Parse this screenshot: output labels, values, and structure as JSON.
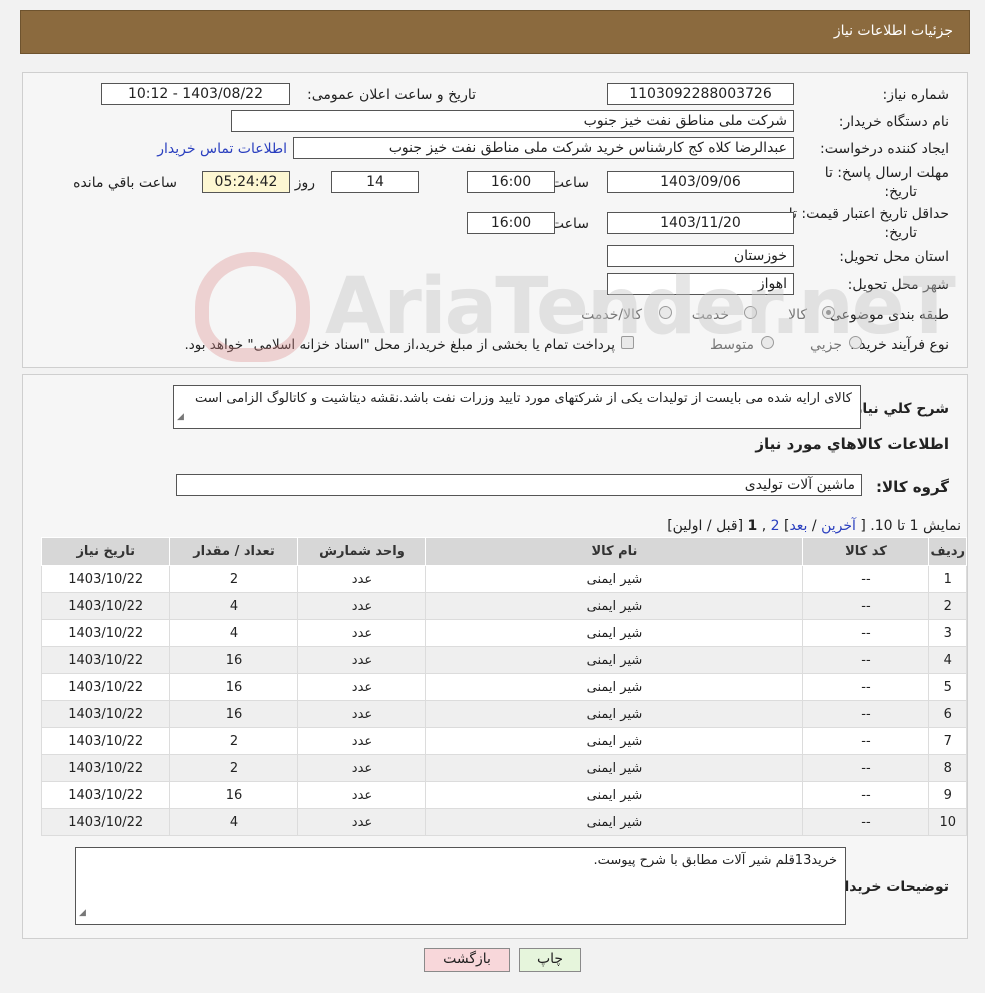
{
  "header": {
    "title": "جزئیات اطلاعات نیاز"
  },
  "details": {
    "need_number_label": "شماره نیاز:",
    "need_number": "1103092288003726",
    "announce_label": "تاریخ و ساعت اعلان عمومی:",
    "announce_value": "1403/08/22 - 10:12",
    "buyer_org_label": "نام دستگاه خریدار:",
    "buyer_org": "شرکت ملی مناطق نفت خیز جنوب",
    "creator_label": "ایجاد کننده درخواست:",
    "creator": "عبدالرضا کلاه کج  کارشناس خرید شرکت ملی مناطق نفت خیز جنوب",
    "contact_link": "اطلاعات تماس خریدار",
    "deadline_label_1": "مهلت ارسال پاسخ: تا",
    "deadline_label_2": "تاریخ:",
    "deadline_date": "1403/09/06",
    "time_label": "ساعت",
    "deadline_time": "16:00",
    "days_value": "14",
    "days_label": "روز و",
    "remaining_time": "05:24:42",
    "remaining_label": "ساعت باقي مانده",
    "validity_label_1": "حداقل تاریخ اعتبار قیمت: تا",
    "validity_label_2": "تاریخ:",
    "validity_date": "1403/11/20",
    "validity_time": "16:00",
    "province_label": "استان محل تحویل:",
    "province": "خوزستان",
    "city_label": "شهر محل تحویل:",
    "city": "اهواز",
    "category_label": "طبقه بندی موضوعی:",
    "category_options": [
      "کالا",
      "خدمت",
      "کالا/خدمت"
    ],
    "process_label": "نوع فرآیند خرید :",
    "process_options": [
      "جزیي",
      "متوسط"
    ],
    "process_note": "پرداخت تمام یا بخشی از مبلغ خرید،از محل \"اسناد خزانه اسلامی\" خواهد بود."
  },
  "watermark": {
    "text": "AriaTender.neT"
  },
  "items_section": {
    "description_label": "شرح كلي نياز:",
    "description": "کالای ارایه شده می بایست از تولیدات یکی از شرکتهای مورد تایید وزرات نفت باشد.نقشه دیتاشیت و کاتالوگ الزامی است",
    "section_title": "اطلاعات كالاهاي مورد نياز",
    "group_label": "گروه كالا:",
    "group_value": "ماشین آلات تولیدی",
    "paging_text": "نمایش 1 تا 10.",
    "paging_bracket_open": "[",
    "paging_last": "آخرین",
    "paging_sep1": "/",
    "paging_next": "بعد",
    "paging_bracket_close": "]",
    "paging_page2": "2",
    "paging_comma": ",",
    "paging_page1": "1",
    "paging_prev_first": "[قبل / اولین]",
    "columns": [
      "ردیف",
      "کد کالا",
      "نام کالا",
      "واحد شمارش",
      "تعداد / مقدار",
      "تاریخ نیاز"
    ],
    "rows": [
      [
        "1",
        "--",
        "شیر ایمنی",
        "عدد",
        "2",
        "1403/10/22"
      ],
      [
        "2",
        "--",
        "شیر ایمنی",
        "عدد",
        "4",
        "1403/10/22"
      ],
      [
        "3",
        "--",
        "شیر ایمنی",
        "عدد",
        "4",
        "1403/10/22"
      ],
      [
        "4",
        "--",
        "شیر ایمنی",
        "عدد",
        "16",
        "1403/10/22"
      ],
      [
        "5",
        "--",
        "شیر ایمنی",
        "عدد",
        "16",
        "1403/10/22"
      ],
      [
        "6",
        "--",
        "شیر ایمنی",
        "عدد",
        "16",
        "1403/10/22"
      ],
      [
        "7",
        "--",
        "شیر ایمنی",
        "عدد",
        "2",
        "1403/10/22"
      ],
      [
        "8",
        "--",
        "شیر ایمنی",
        "عدد",
        "2",
        "1403/10/22"
      ],
      [
        "9",
        "--",
        "شیر ایمنی",
        "عدد",
        "16",
        "1403/10/22"
      ],
      [
        "10",
        "--",
        "شیر ایمنی",
        "عدد",
        "4",
        "1403/10/22"
      ]
    ],
    "buyer_notes_label": "توضیحات خریدار:",
    "buyer_notes": "خرید13قلم شیر آلات مطابق با شرح پیوست."
  },
  "buttons": {
    "print": "چاپ",
    "back": "بازگشت"
  },
  "colors": {
    "header_bg": "#8b6a3e",
    "link": "#2a3fbf",
    "back_btn": "#f8d7da",
    "print_btn": "#e6f5dc"
  }
}
